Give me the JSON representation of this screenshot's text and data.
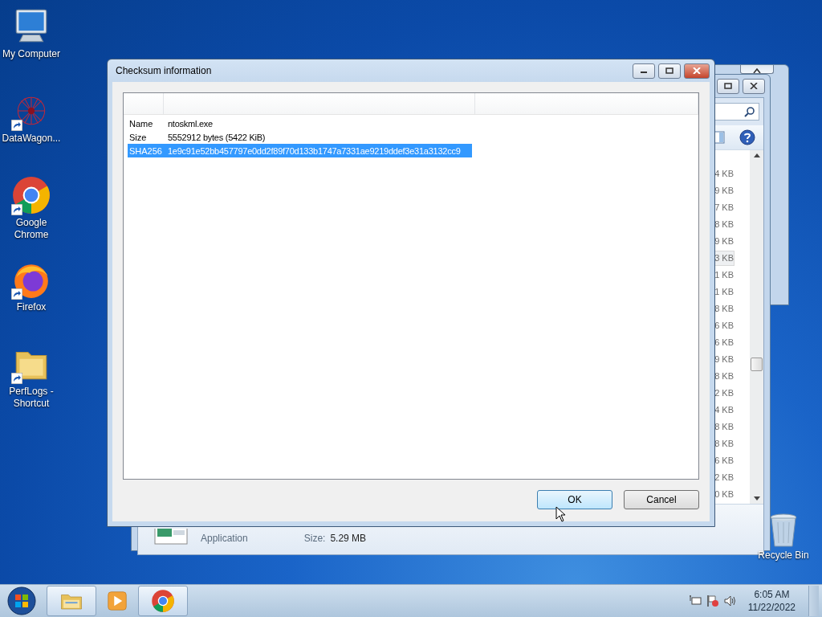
{
  "desktop_icons": [
    {
      "label": "My Computer",
      "kind": "computer",
      "shortcut": false
    },
    {
      "label": "DataWagon...",
      "kind": "network",
      "shortcut": true
    },
    {
      "label": "Google Chrome",
      "kind": "chrome",
      "shortcut": true
    },
    {
      "label": "Firefox",
      "kind": "firefox",
      "shortcut": true
    },
    {
      "label": "PerfLogs - Shortcut",
      "kind": "folder",
      "shortcut": true
    }
  ],
  "recycle_bin": {
    "label": "Recycle Bin"
  },
  "explorer_window": {
    "size_items": [
      {
        "text": "4 KB",
        "selected": false
      },
      {
        "text": "9 KB",
        "selected": false
      },
      {
        "text": "7 KB",
        "selected": false
      },
      {
        "text": "8 KB",
        "selected": false
      },
      {
        "text": "9 KB",
        "selected": false
      },
      {
        "text": "3 KB",
        "selected": true
      },
      {
        "text": "1 KB",
        "selected": false
      },
      {
        "text": "1 KB",
        "selected": false
      },
      {
        "text": "8 KB",
        "selected": false
      },
      {
        "text": "6 KB",
        "selected": false
      },
      {
        "text": "6 KB",
        "selected": false
      },
      {
        "text": "9 KB",
        "selected": false
      },
      {
        "text": "8 KB",
        "selected": false
      },
      {
        "text": "2 KB",
        "selected": false
      },
      {
        "text": "4 KB",
        "selected": false
      },
      {
        "text": "8 KB",
        "selected": false
      },
      {
        "text": "8 KB",
        "selected": false
      },
      {
        "text": "6 KB",
        "selected": false
      },
      {
        "text": "2 KB",
        "selected": false
      },
      {
        "text": "0 KB",
        "selected": false
      }
    ],
    "details": {
      "type": "Application",
      "size_label": "Size:",
      "size_value": "5.29 MB"
    }
  },
  "dialog": {
    "title": "Checksum information",
    "rows": [
      {
        "key": "Name",
        "value": "ntoskml.exe",
        "selected": false
      },
      {
        "key": "Size",
        "value": "5552912 bytes (5422 KiB)",
        "selected": false
      },
      {
        "key": "SHA256",
        "value": "1e9c91e52bb457797e0dd2f89f70d133b1747a7331ae9219ddef3e31a3132cc9",
        "selected": true
      }
    ],
    "buttons": [
      {
        "label": "OK",
        "kind": "default"
      },
      {
        "label": "Cancel",
        "kind": "normal"
      }
    ]
  },
  "taskbar": {
    "apps": [
      {
        "kind": "explorer",
        "active": true
      },
      {
        "kind": "media",
        "active": false
      },
      {
        "kind": "chrome",
        "active": true
      }
    ],
    "clock": {
      "time": "6:05 AM",
      "date": "11/22/2022"
    }
  }
}
